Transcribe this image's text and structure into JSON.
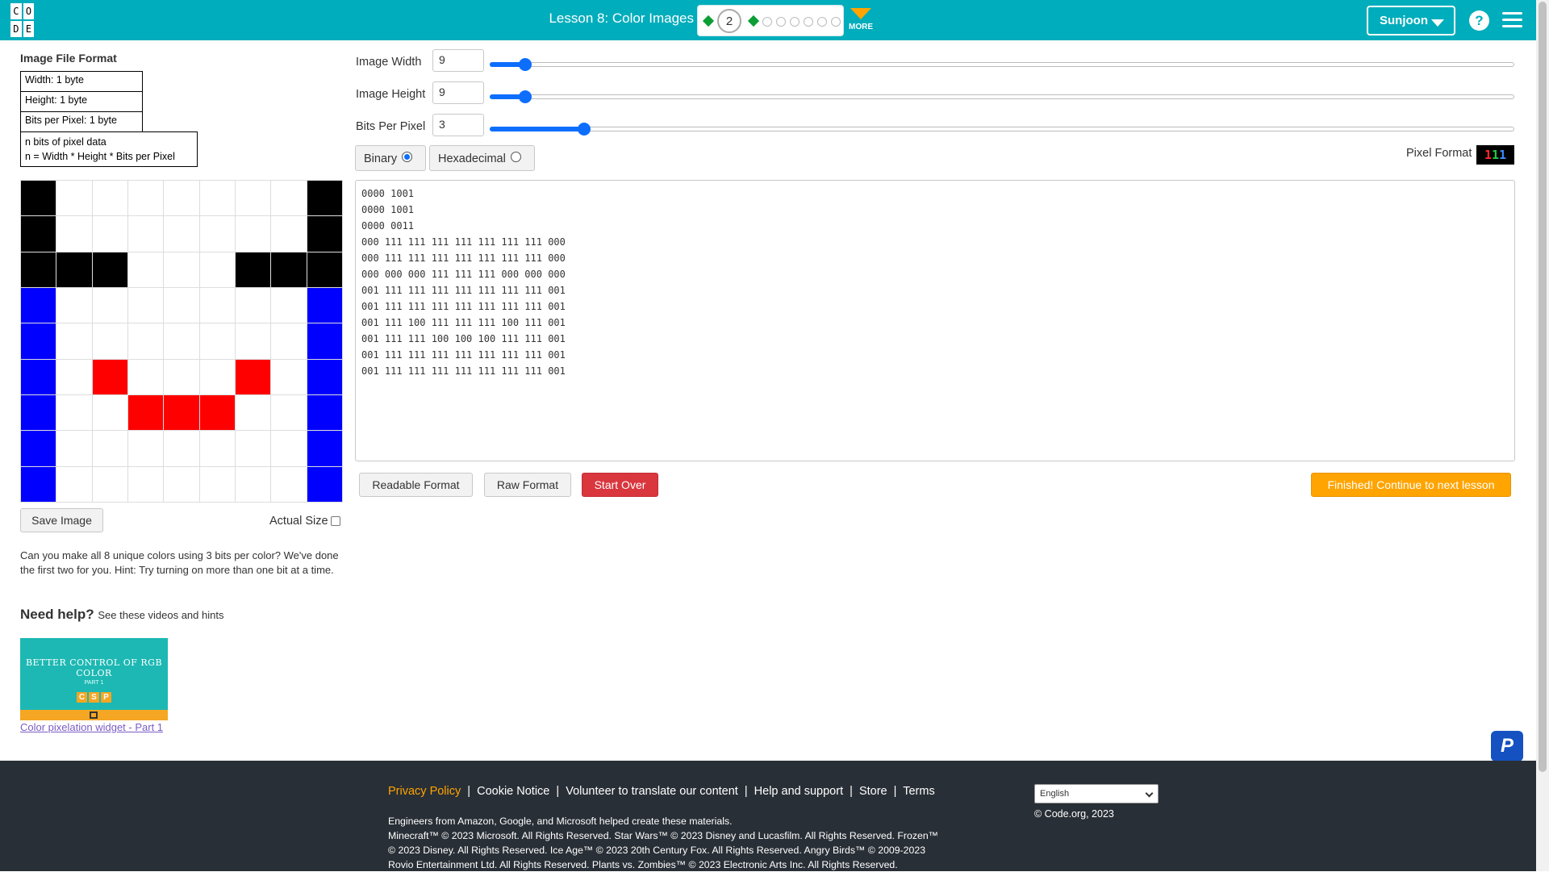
{
  "header": {
    "logo_letters": [
      "C",
      "O",
      "",
      "D",
      "E",
      ""
    ],
    "lesson_title": "Lesson 8: Color Images",
    "current_level": "2",
    "more_label": "MORE",
    "user_name": "Sunjoon",
    "help_glyph": "?",
    "accent_color": "#00adbc"
  },
  "format_panel": {
    "title": "Image File Format",
    "width_label": "Width: 1 byte",
    "height_label": "Height: 1 byte",
    "bpp_label": "Bits per Pixel: 1 byte",
    "pixel_data_line1": "n bits of pixel data",
    "pixel_data_line2": "n = Width * Height * Bits per Pixel"
  },
  "pixel_grid": {
    "colors": {
      "0": "#000000",
      "1": "#0000ff",
      "4": "#ff0000",
      "7": "#ffffff"
    },
    "rows": [
      [
        0,
        7,
        7,
        7,
        7,
        7,
        7,
        7,
        0
      ],
      [
        0,
        7,
        7,
        7,
        7,
        7,
        7,
        7,
        0
      ],
      [
        0,
        0,
        0,
        7,
        7,
        7,
        0,
        0,
        0
      ],
      [
        1,
        7,
        7,
        7,
        7,
        7,
        7,
        7,
        1
      ],
      [
        1,
        7,
        7,
        7,
        7,
        7,
        7,
        7,
        1
      ],
      [
        1,
        7,
        4,
        7,
        7,
        7,
        4,
        7,
        1
      ],
      [
        1,
        7,
        7,
        4,
        4,
        4,
        7,
        7,
        1
      ],
      [
        1,
        7,
        7,
        7,
        7,
        7,
        7,
        7,
        1
      ],
      [
        1,
        7,
        7,
        7,
        7,
        7,
        7,
        7,
        1
      ]
    ]
  },
  "left_controls": {
    "save_image": "Save Image",
    "actual_size": "Actual Size"
  },
  "instructions": "Can you make all 8 unique colors using 3 bits per color? We've done the first two for you. Hint: Try turning on more than one bit at a time.",
  "help": {
    "title": "Need help?",
    "subtitle": "See these videos and hints",
    "video_thumb_title": "BETTER CONTROL OF RGB COLOR",
    "video_thumb_part": "PART 1",
    "video_thumb_letters": [
      "C",
      "S",
      "P"
    ],
    "video_link": "Color pixelation widget - Part 1"
  },
  "settings": {
    "width_label": "Image Width",
    "width_value": "9",
    "width_fraction": 0.035,
    "height_label": "Image Height",
    "height_value": "9",
    "height_fraction": 0.035,
    "bpp_label": "Bits Per Pixel",
    "bpp_value": "3",
    "bpp_fraction": 0.092
  },
  "encoding": {
    "binary_label": "Binary",
    "hex_label": "Hexadecimal",
    "selected": "binary"
  },
  "pixel_format": {
    "label": "Pixel Format",
    "bits": [
      {
        "text": "1",
        "color": "#ff2a2a"
      },
      {
        "text": "1",
        "color": "#22cc44"
      },
      {
        "text": "1",
        "color": "#3b8bff"
      }
    ]
  },
  "binary_data": [
    "0000 1001",
    "0000 1001",
    "0000 0011",
    "000 111 111 111 111 111 111 111 000",
    "000 111 111 111 111 111 111 111 000",
    "000 000 000 111 111 111 000 000 000",
    "001 111 111 111 111 111 111 111 001",
    "001 111 111 111 111 111 111 111 001",
    "001 111 100 111 111 111 100 111 001",
    "001 111 111 100 100 100 111 111 001",
    "001 111 111 111 111 111 111 111 001",
    "001 111 111 111 111 111 111 111 001"
  ],
  "actions": {
    "readable": "Readable Format",
    "raw": "Raw Format",
    "start_over": "Start Over",
    "finished": "Finished! Continue to next lesson"
  },
  "float_button": "P",
  "footer": {
    "links": [
      "Privacy Policy",
      "Cookie Notice",
      "Volunteer to translate our content",
      "Help and support",
      "Store",
      "Terms"
    ],
    "separator": "|",
    "copy_lines": [
      "Engineers from Amazon, Google, and Microsoft helped create these materials.",
      "Minecraft™ © 2023 Microsoft. All Rights Reserved. Star Wars™ © 2023 Disney and Lucasfilm. All Rights Reserved. Frozen™",
      "© 2023 Disney. All Rights Reserved. Ice Age™ © 2023 20th Century Fox. All Rights Reserved. Angry Birds™ © 2009-2023",
      "Rovio Entertainment Ltd. All Rights Reserved. Plants vs. Zombies™ © 2023 Electronic Arts Inc. All Rights Reserved."
    ],
    "language": "English",
    "copyright": "© Code.org, 2023"
  }
}
